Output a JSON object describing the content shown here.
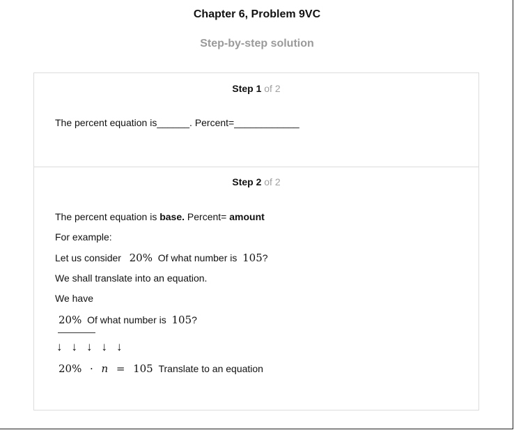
{
  "header": {
    "title": "Chapter 6, Problem 9VC",
    "subtitle": "Step-by-step solution"
  },
  "step1": {
    "label": "Step 1",
    "of": "of 2",
    "text": "The percent equation is______. Percent=____________"
  },
  "step2": {
    "label": "Step 2",
    "of": "of 2",
    "line1_a": "The percent equation is ",
    "line1_b": "base.",
    "line1_c": " Percent= ",
    "line1_d": "amount",
    "line2": "For example:",
    "line3_a": "Let us consider",
    "line3_m1": "20%",
    "line3_b": "Of what number is",
    "line3_m2": "105",
    "line3_c": "?",
    "line4": "We shall translate into an equation.",
    "line5": "We have",
    "line6_m1": "20%",
    "line6_b": "Of what number is",
    "line6_m2": "105",
    "line6_c": "?",
    "arrows": [
      "↓",
      "↓",
      "↓",
      "↓",
      "↓"
    ],
    "eq_m1": "20%",
    "eq_dot": "·",
    "eq_n": "n",
    "eq_eq": "=",
    "eq_m2": "105",
    "eq_text": "Translate to an equation"
  }
}
